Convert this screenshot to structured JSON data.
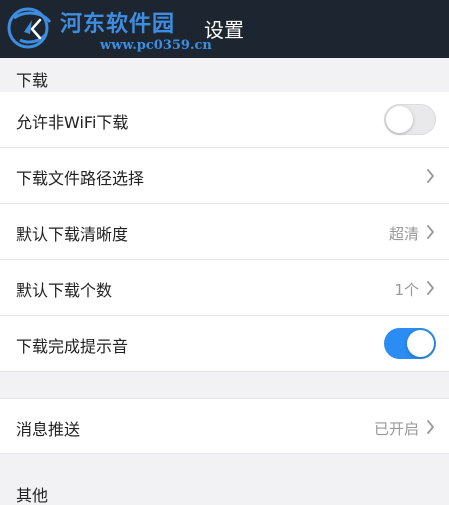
{
  "watermark": {
    "title": "河东软件园",
    "url": "www.pc0359.cn"
  },
  "header": {
    "title": "设置",
    "back_icon": "chevron-left-icon"
  },
  "sections": {
    "download": {
      "title": "下载",
      "wifi_label": "允许非WiFi下载",
      "wifi_enabled": false,
      "path_label": "下载文件路径选择",
      "quality_label": "默认下载清晰度",
      "quality_value": "超清",
      "count_label": "默认下载个数",
      "count_value": "1个",
      "sound_label": "下载完成提示音",
      "sound_enabled": true
    },
    "push": {
      "label": "消息推送",
      "value": "已开启"
    },
    "other": {
      "title": "其他"
    }
  },
  "colors": {
    "header_bg": "#1d2530",
    "accent": "#2b8cf3",
    "watermark": "#3d8ee0",
    "page_bg": "#f2f2f4"
  }
}
